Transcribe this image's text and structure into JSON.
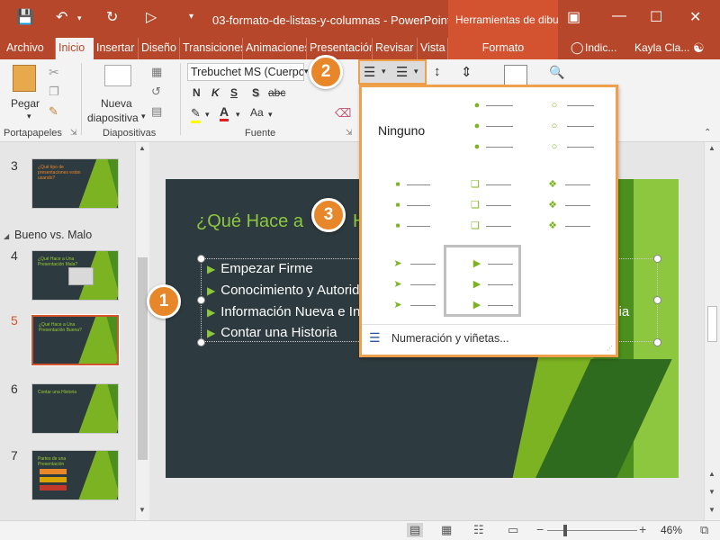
{
  "window": {
    "title": "03-formato-de-listas-y-columnas - PowerPoint",
    "tools_title": "Herramientas de dibujo"
  },
  "tabs": [
    "Archivo",
    "Inicio",
    "Insertar",
    "Diseño",
    "Transiciones",
    "Animaciones",
    "Presentación",
    "Revisar",
    "Vista"
  ],
  "contextual_tab": "Formato",
  "tell_me": "Indic...",
  "user": "Kayla Cla...",
  "ribbon": {
    "paste_label": "Pegar",
    "new_slide_line1": "Nueva",
    "new_slide_line2": "diapositiva",
    "font_name": "Trebuchet MS (Cuerpo",
    "bold": "N",
    "italic": "K",
    "underline": "S",
    "shadow": "S",
    "strike": "abc",
    "case": "Aa",
    "groups": {
      "clipboard": "Portapapeles",
      "slides": "Diapositivas",
      "font": "Fuente"
    }
  },
  "slides_panel": {
    "section_name": "Bueno vs. Malo",
    "slides": [
      {
        "num": "3",
        "title": "¿Qué tipo de presentaciones están usando?"
      },
      {
        "num": "4",
        "title": "¿Qué Hace a Una Presentación Mala?"
      },
      {
        "num": "5",
        "title": "¿Qué Hace a Una Presentación Buena?"
      },
      {
        "num": "6",
        "title": "Contar una Historia"
      },
      {
        "num": "7",
        "title": "Partes de una Presentación"
      }
    ]
  },
  "slide": {
    "title": "¿Qué Hace a Una Presentación Buena?",
    "title_visible": "¿Qué Hace a",
    "title_tail": "H",
    "bullets": [
      "Empezar Firme",
      "Conocimiento y Autorid",
      "Información Nueva e In",
      "Contar una Historia"
    ],
    "bullet_right_fragment": "cia"
  },
  "dropdown": {
    "none_label": "Ninguno",
    "footer": "Numeración y viñetas...",
    "styles": [
      "dot",
      "hollow-circle",
      "square",
      "hollow-square",
      "four-diamond",
      "arrowhead",
      "triangle"
    ]
  },
  "status": {
    "zoom": "46%"
  },
  "callouts": [
    "1",
    "2",
    "3"
  ],
  "colors": {
    "brand": "#b7472a",
    "accent_green": "#8dc63f",
    "callout": "#e8862a",
    "highlight_border": "#f0a04b"
  }
}
